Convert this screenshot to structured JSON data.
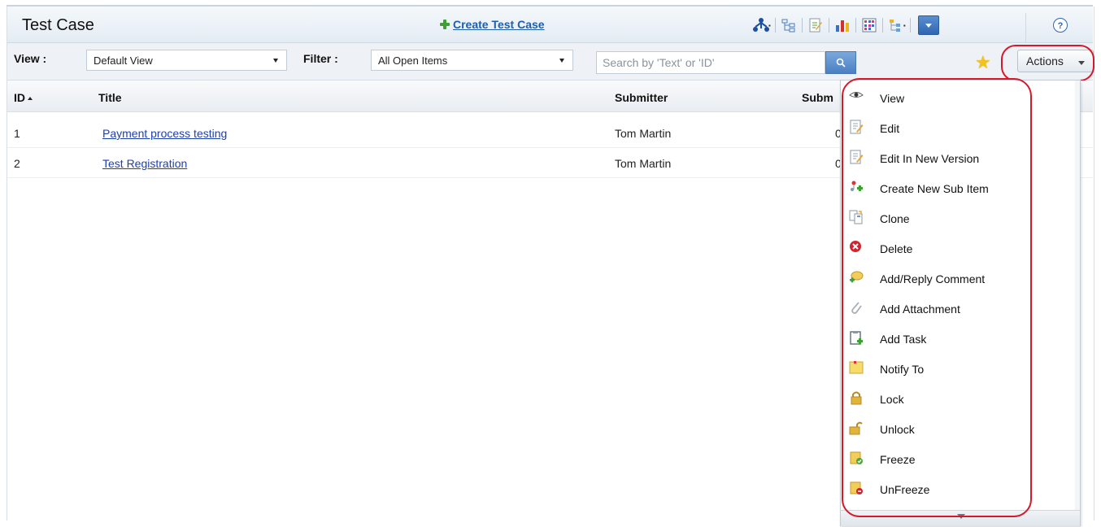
{
  "header": {
    "title": "Test Case",
    "create_label": "Create Test Case",
    "help_label": "?"
  },
  "toolbar": {
    "icons": [
      "hierarchy-icon",
      "tree-icon",
      "edit-doc-icon",
      "bar-chart-icon",
      "grid-icon",
      "structure-icon",
      "dropdown-icon"
    ]
  },
  "filterbar": {
    "view_label": "View :",
    "view_value": "Default View",
    "filter_label": "Filter :",
    "filter_value": "All Open Items",
    "search_placeholder": "Search by 'Text' or 'ID'",
    "actions_label": "Actions"
  },
  "table": {
    "columns": [
      "ID",
      "Title",
      "Submitter",
      "Subm"
    ],
    "rows": [
      {
        "id": "1",
        "title": "Payment process testing",
        "submitter": "Tom Martin",
        "extra": "0"
      },
      {
        "id": "2",
        "title": "Test Registration",
        "submitter": "Tom Martin",
        "extra": "0"
      }
    ]
  },
  "actions_menu": {
    "items": [
      {
        "label": "View",
        "icon": "eye-icon"
      },
      {
        "label": "Edit",
        "icon": "edit-icon"
      },
      {
        "label": "Edit In New Version",
        "icon": "edit-version-icon"
      },
      {
        "label": "Create New Sub Item",
        "icon": "sub-item-icon"
      },
      {
        "label": "Clone",
        "icon": "clone-icon"
      },
      {
        "label": "Delete",
        "icon": "delete-icon"
      },
      {
        "label": "Add/Reply Comment",
        "icon": "comment-icon"
      },
      {
        "label": "Add Attachment",
        "icon": "paperclip-icon"
      },
      {
        "label": "Add Task",
        "icon": "task-icon"
      },
      {
        "label": "Notify To",
        "icon": "note-icon"
      },
      {
        "label": "Lock",
        "icon": "lock-icon"
      },
      {
        "label": "Unlock",
        "icon": "unlock-icon"
      },
      {
        "label": "Freeze",
        "icon": "freeze-icon"
      },
      {
        "label": "UnFreeze",
        "icon": "unfreeze-icon"
      }
    ]
  },
  "colors": {
    "link": "#1d3fb0",
    "highlight_ring": "#d3192a",
    "accent_blue": "#2f66b0"
  }
}
